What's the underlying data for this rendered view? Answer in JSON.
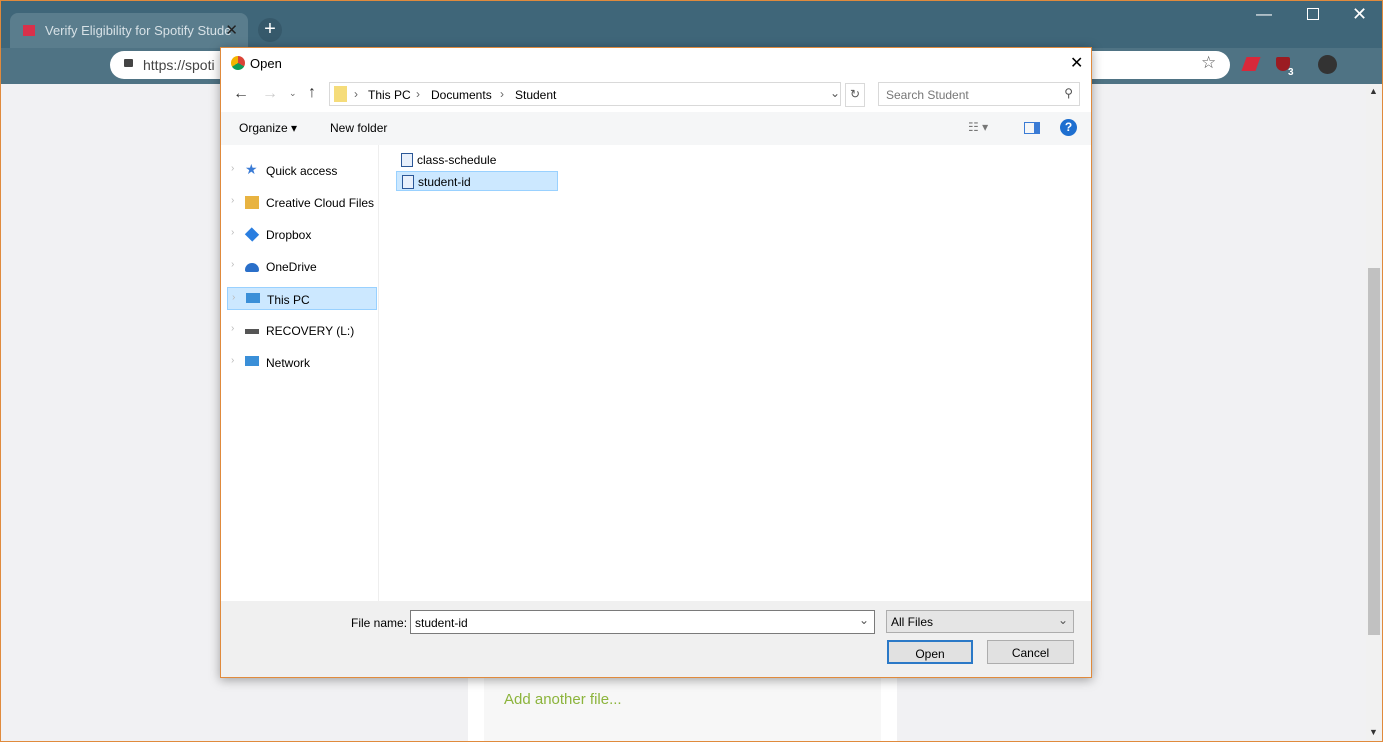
{
  "browser": {
    "tab_title": "Verify Eligibility for Spotify Stude",
    "url": "https://spoti",
    "extension_badge": "3"
  },
  "page": {
    "add_file_link": "Add another file..."
  },
  "dialog": {
    "title": "Open",
    "breadcrumb": [
      "This PC",
      "Documents",
      "Student"
    ],
    "search_placeholder": "Search Student",
    "organize": "Organize",
    "new_folder": "New folder",
    "nav": [
      {
        "label": "Quick access",
        "icon": "star-icon",
        "color": "#3a7bd5"
      },
      {
        "label": "Creative Cloud Files",
        "icon": "creative-cloud-icon",
        "color": "#e8b341"
      },
      {
        "label": "Dropbox",
        "icon": "dropbox-icon",
        "color": "#2a7ee0"
      },
      {
        "label": "OneDrive",
        "icon": "onedrive-icon",
        "color": "#2a6fc9"
      },
      {
        "label": "This PC",
        "icon": "computer-icon",
        "color": "#3a8fd8",
        "selected": true
      },
      {
        "label": "RECOVERY (L:)",
        "icon": "drive-icon",
        "color": "#555555"
      },
      {
        "label": "Network",
        "icon": "network-icon",
        "color": "#3a8fd8"
      }
    ],
    "files": [
      {
        "name": "class-schedule"
      },
      {
        "name": "student-id",
        "selected": true
      }
    ],
    "file_name_label": "File name:",
    "file_name_value": "student-id",
    "file_type": "All Files",
    "open_button": "Open",
    "cancel_button": "Cancel"
  }
}
